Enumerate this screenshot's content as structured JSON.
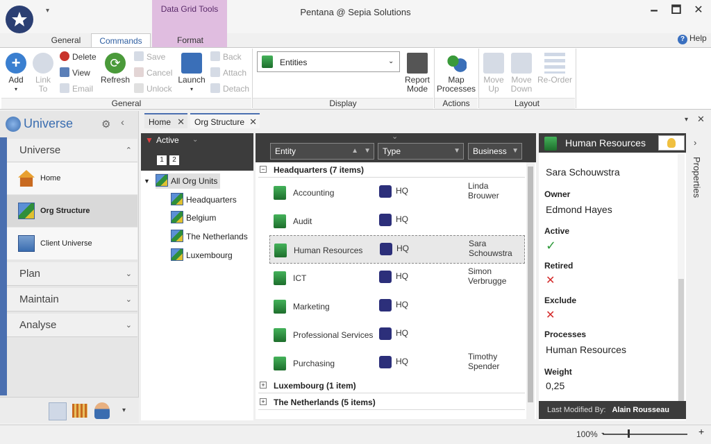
{
  "window": {
    "title": "Pentana @ Sepia Solutions",
    "min": "🗕",
    "max": "🗖",
    "close": "✕"
  },
  "ribbon_tabs": {
    "general": "General",
    "commands": "Commands",
    "format": "Format",
    "context_group": "Data Grid Tools",
    "help": "Help"
  },
  "ribbon": {
    "general": {
      "label": "General",
      "add": "Add",
      "link": "Link",
      "to": "To",
      "delete": "Delete",
      "view": "View",
      "email": "Email",
      "refresh": "Refresh",
      "save": "Save",
      "cancel": "Cancel",
      "unlock": "Unlock",
      "launch": "Launch",
      "back": "Back",
      "attach": "Attach",
      "detach": "Detach"
    },
    "display": {
      "label": "Display",
      "selected_value": "Entities",
      "report": "Report",
      "mode": "Mode"
    },
    "actions": {
      "label": "Actions",
      "map": "Map",
      "processes": "Processes"
    },
    "layout": {
      "label": "Layout",
      "move_up_1": "Move",
      "move_up_2": "Up",
      "move_down_1": "Move",
      "move_down_2": "Down",
      "reorder": "Re-Order"
    }
  },
  "leftnav": {
    "title": "Universe",
    "sections": [
      {
        "label": "Universe",
        "chevron": "⌃"
      },
      {
        "label": "Plan",
        "chevron": "⌄"
      },
      {
        "label": "Maintain",
        "chevron": "⌄"
      },
      {
        "label": "Analyse",
        "chevron": "⌄"
      }
    ],
    "items": [
      {
        "label": "Home"
      },
      {
        "label": "Org Structure"
      },
      {
        "label": "Client Universe"
      }
    ]
  },
  "doc_tabs": [
    {
      "label": "Home"
    },
    {
      "label": "Org Structure"
    }
  ],
  "tree": {
    "filter": "Active",
    "levels": [
      "1",
      "2"
    ],
    "root": "All Org Units",
    "children": [
      "Headquarters",
      "Belgium",
      "The Netherlands",
      "Luxembourg"
    ]
  },
  "grid": {
    "columns": [
      "Entity",
      "Type",
      "Business"
    ],
    "groups": [
      {
        "label": "Headquarters (7 items)",
        "toggle": "−"
      },
      {
        "label": "Luxembourg (1 item)",
        "toggle": "+"
      },
      {
        "label": "The Netherlands (5 items)",
        "toggle": "+"
      }
    ],
    "rows": [
      {
        "entity": "Accounting",
        "type": "HQ",
        "business_1": "Linda",
        "business_2": "Brouwer"
      },
      {
        "entity": "Audit",
        "type": "HQ",
        "business_1": "",
        "business_2": ""
      },
      {
        "entity": "Human Resources",
        "type": "HQ",
        "business_1": "Sara",
        "business_2": "Schouwstra"
      },
      {
        "entity": "ICT",
        "type": "HQ",
        "business_1": "Simon",
        "business_2": "Verbrugge"
      },
      {
        "entity": "Marketing",
        "type": "HQ",
        "business_1": "",
        "business_2": ""
      },
      {
        "entity": "Professional Services",
        "type": "HQ",
        "business_1": "",
        "business_2": ""
      },
      {
        "entity": "Purchasing",
        "type": "HQ",
        "business_1": "Timothy",
        "business_2": "Spender"
      }
    ]
  },
  "properties": {
    "title": "Human Resources",
    "panel_label": "Properties",
    "top_value": "Sara Schouwstra",
    "owner_label": "Owner",
    "owner": "Edmond Hayes",
    "active_label": "Active",
    "active": "✓",
    "retired_label": "Retired",
    "retired": "✕",
    "exclude_label": "Exclude",
    "exclude": "✕",
    "processes_label": "Processes",
    "processes": "Human Resources",
    "weight_label": "Weight",
    "weight": "0,25",
    "modified_label": "Last Modified By:",
    "modified_by": "Alain Rousseau"
  },
  "status": {
    "zoom": "100%",
    "zoom_minus": "-",
    "zoom_plus": "+"
  }
}
